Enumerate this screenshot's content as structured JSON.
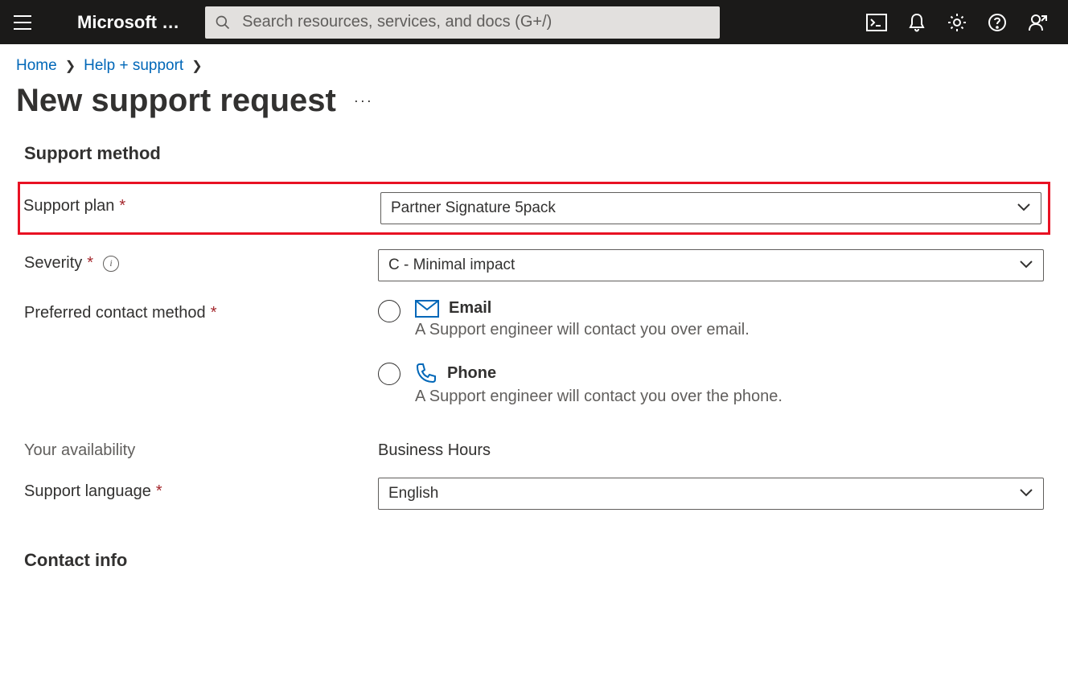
{
  "header": {
    "brand": "Microsoft …",
    "search_placeholder": "Search resources, services, and docs (G+/)"
  },
  "breadcrumb": {
    "items": [
      "Home",
      "Help + support"
    ]
  },
  "page": {
    "title": "New support request"
  },
  "form": {
    "section_support_method": "Support method",
    "support_plan": {
      "label": "Support plan",
      "value": "Partner Signature 5pack"
    },
    "severity": {
      "label": "Severity",
      "value": "C - Minimal impact"
    },
    "preferred_contact": {
      "label": "Preferred contact method",
      "options": [
        {
          "label": "Email",
          "desc": "A Support engineer will contact you over email."
        },
        {
          "label": "Phone",
          "desc": "A Support engineer will contact you over the phone."
        }
      ]
    },
    "availability": {
      "label": "Your availability",
      "value": "Business Hours"
    },
    "support_language": {
      "label": "Support language",
      "value": "English"
    },
    "section_contact_info": "Contact info"
  }
}
